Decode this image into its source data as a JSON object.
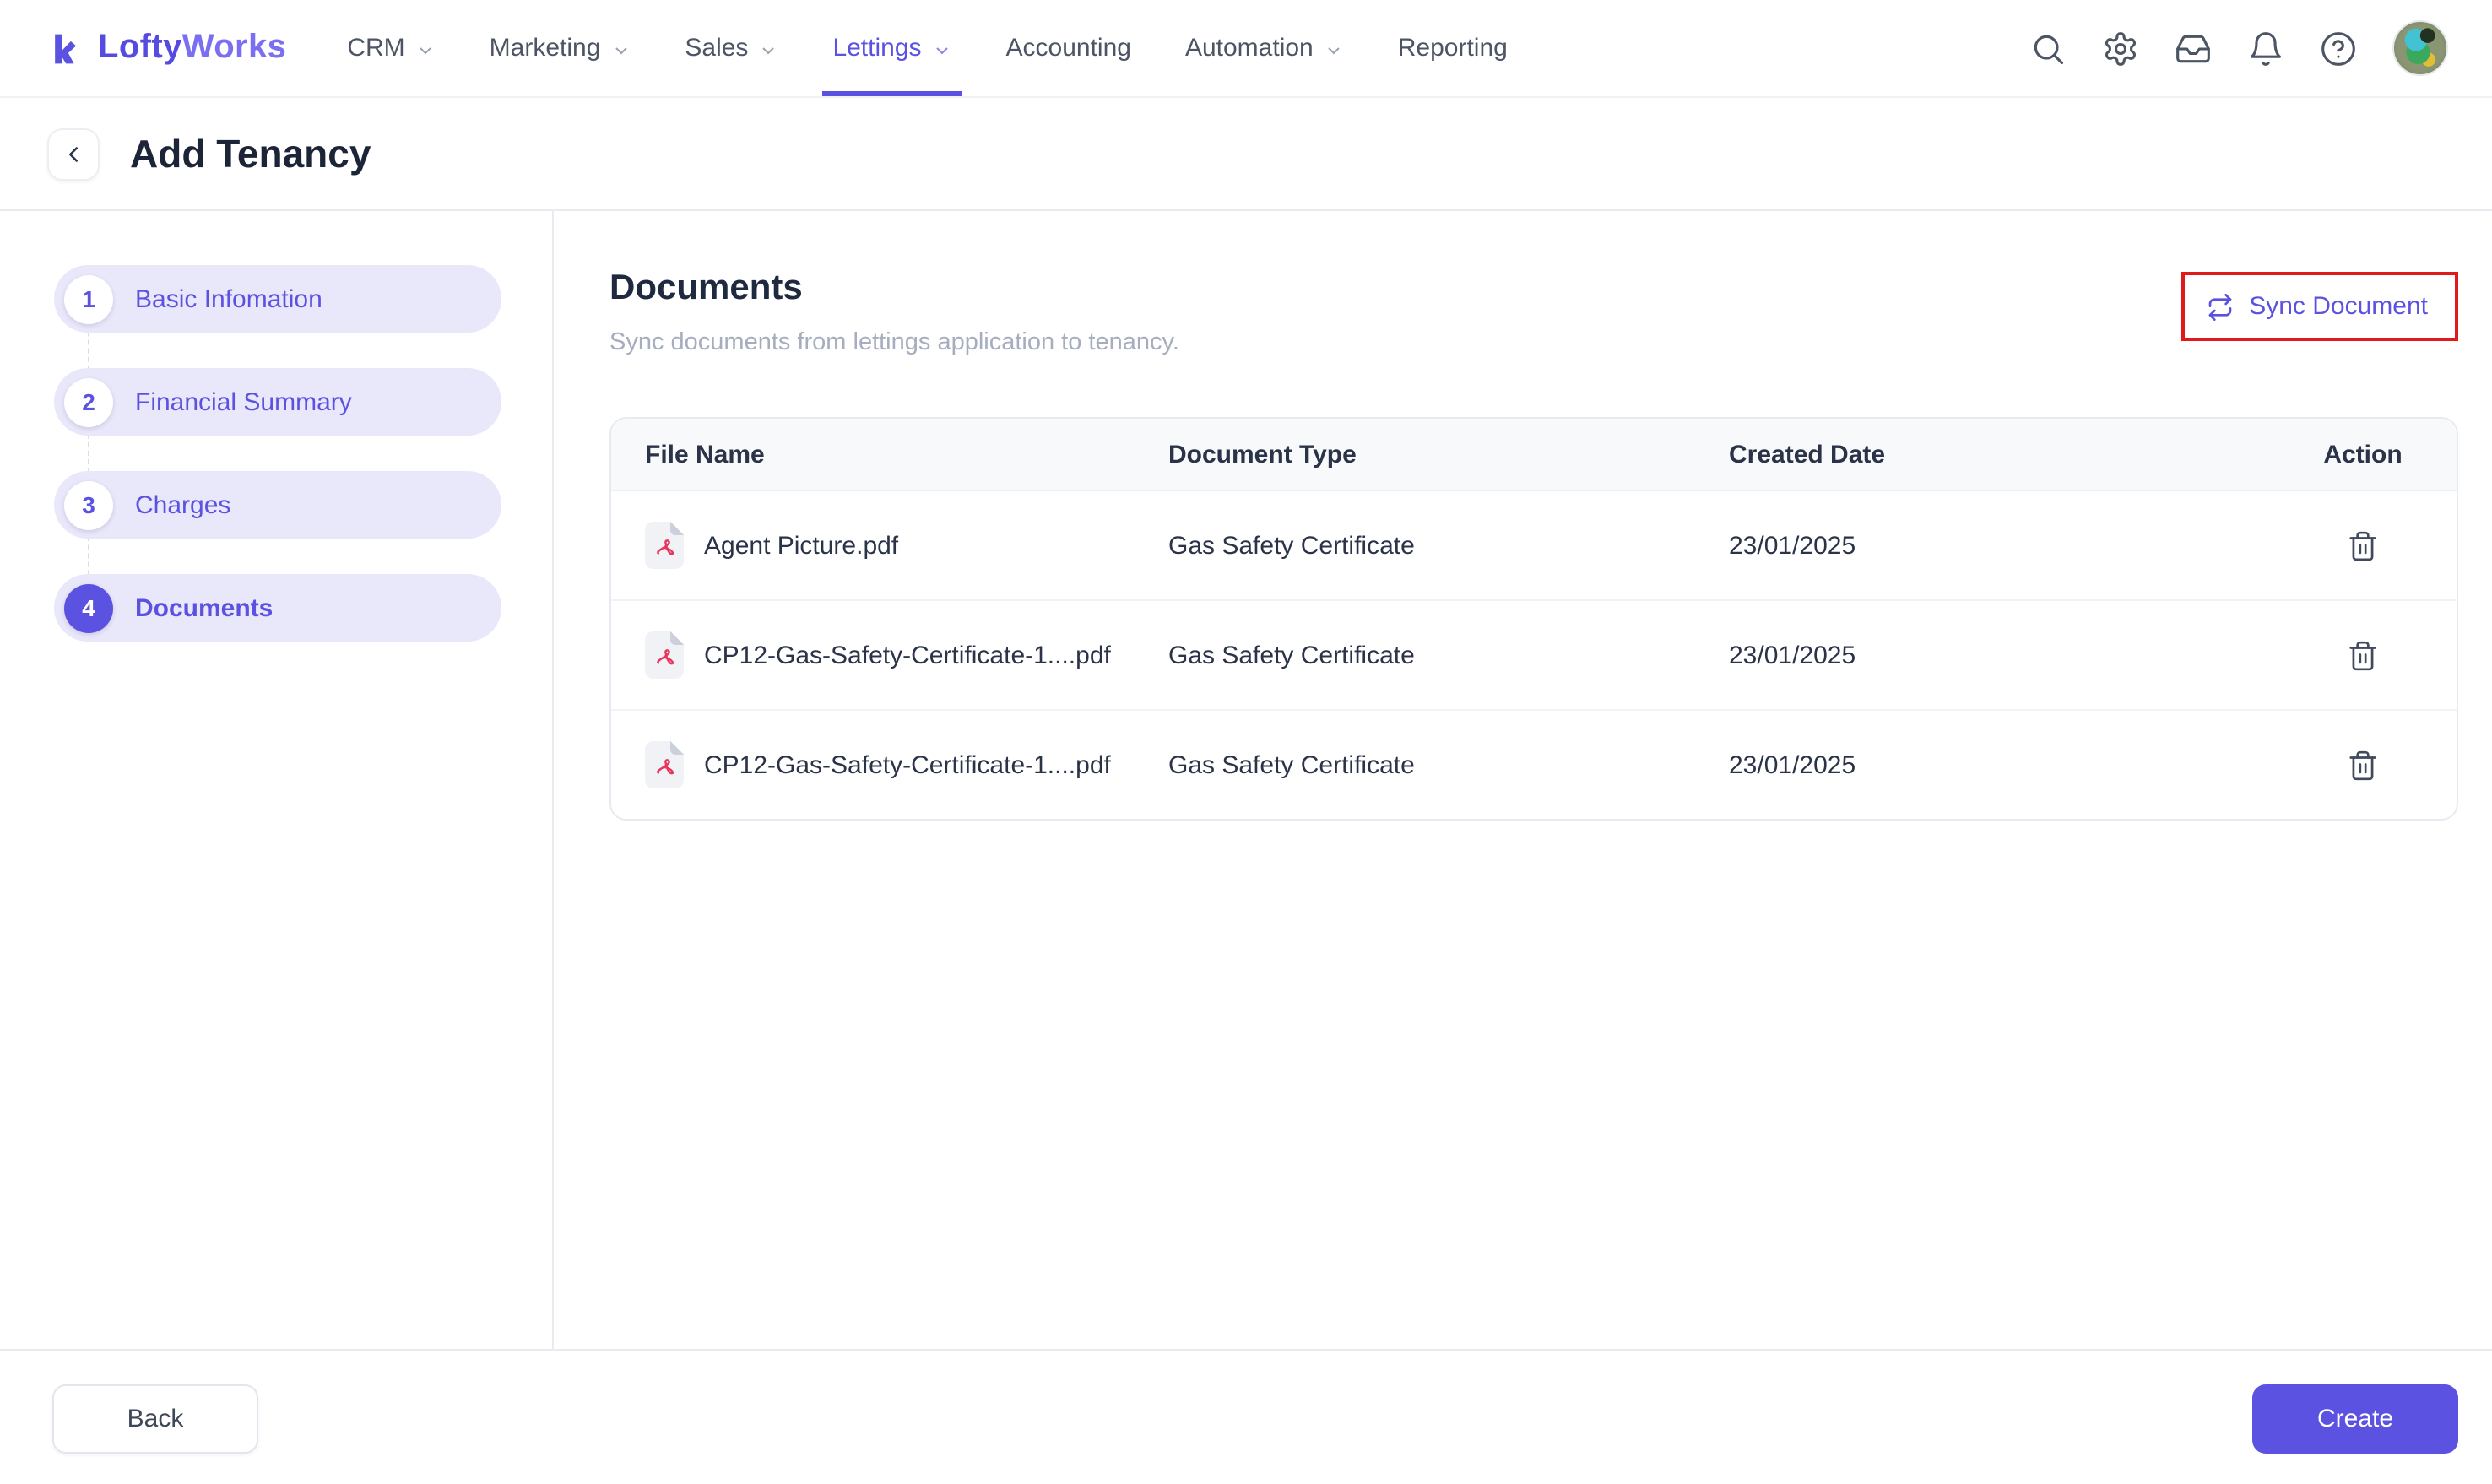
{
  "brand": {
    "name_primary": "Lofty",
    "name_secondary": "Works"
  },
  "nav": {
    "items": [
      {
        "label": "CRM",
        "dropdown": true,
        "active": false
      },
      {
        "label": "Marketing",
        "dropdown": true,
        "active": false
      },
      {
        "label": "Sales",
        "dropdown": true,
        "active": false
      },
      {
        "label": "Lettings",
        "dropdown": true,
        "active": true
      },
      {
        "label": "Accounting",
        "dropdown": false,
        "active": false
      },
      {
        "label": "Automation",
        "dropdown": true,
        "active": false
      },
      {
        "label": "Reporting",
        "dropdown": false,
        "active": false
      }
    ],
    "icons": [
      "search-icon",
      "gear-icon",
      "inbox-icon",
      "bell-icon",
      "help-icon",
      "avatar"
    ]
  },
  "page": {
    "title": "Add Tenancy"
  },
  "stepper": {
    "steps": [
      {
        "number": "1",
        "label": "Basic Infomation",
        "active": false
      },
      {
        "number": "2",
        "label": "Financial Summary",
        "active": false
      },
      {
        "number": "3",
        "label": "Charges",
        "active": false
      },
      {
        "number": "4",
        "label": "Documents",
        "active": true
      }
    ]
  },
  "documents": {
    "title": "Documents",
    "subtitle": "Sync documents from lettings application to tenancy.",
    "sync_button_label": "Sync Document",
    "table": {
      "columns": [
        "File Name",
        "Document Type",
        "Created Date",
        "Action"
      ],
      "rows": [
        {
          "file_name": "Agent Picture.pdf",
          "file_icon": "pdf-file-icon",
          "document_type": "Gas Safety Certificate",
          "created_date": "23/01/2025"
        },
        {
          "file_name": "CP12-Gas-Safety-Certificate-1....pdf",
          "file_icon": "pdf-file-icon",
          "document_type": "Gas Safety Certificate",
          "created_date": "23/01/2025"
        },
        {
          "file_name": "CP12-Gas-Safety-Certificate-1....pdf",
          "file_icon": "pdf-file-icon",
          "document_type": "Gas Safety Certificate",
          "created_date": "23/01/2025"
        }
      ]
    }
  },
  "footer": {
    "back_label": "Back",
    "create_label": "Create"
  },
  "colors": {
    "accent": "#5B52E1",
    "step_pill": "#E9E7FA",
    "highlight_red": "#E01A1A",
    "pdf_red": "#E8355C",
    "title_navy": "#1C2437"
  }
}
